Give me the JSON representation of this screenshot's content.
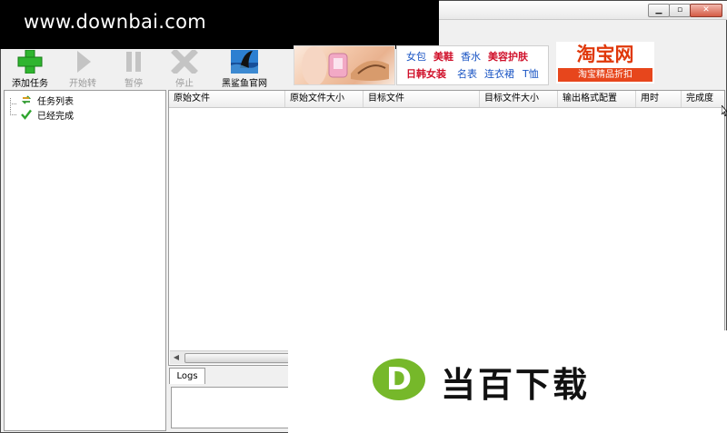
{
  "watermark": {
    "text": "www.downbai.com"
  },
  "window": {
    "min": "▁",
    "max": "▫",
    "close": "✕"
  },
  "toolbar": {
    "add_task": "添加任务",
    "start": "开始转",
    "pause": "暂停",
    "stop": "停止",
    "official_site": "黑鲨鱼官网"
  },
  "ads": {
    "links": [
      {
        "text": "女包",
        "color": "#1a55c4"
      },
      {
        "text": "美鞋",
        "color": "#d0102a"
      },
      {
        "text": "香水",
        "color": "#1a55c4"
      },
      {
        "text": "美容护肤",
        "color": "#d0102a"
      },
      {
        "text": "日韩女装",
        "color": "#d0102a"
      },
      {
        "text": "名表",
        "color": "#1a55c4"
      },
      {
        "text": "连衣裙",
        "color": "#1a55c4"
      },
      {
        "text": "T恤",
        "color": "#1a55c4"
      }
    ],
    "taobao_title": "淘宝网",
    "taobao_sub": "淘宝精品折扣"
  },
  "tree": {
    "items": [
      {
        "label": "任务列表",
        "icon": "refresh-icon"
      },
      {
        "label": "已经完成",
        "icon": "checkmark-icon"
      }
    ]
  },
  "table": {
    "columns": [
      "原始文件",
      "原始文件大小",
      "目标文件",
      "目标文件大小",
      "输出格式配置",
      "用时",
      "完成度"
    ]
  },
  "logs": {
    "tab": "Logs"
  },
  "logo": {
    "mark": "D",
    "text": "当百下载"
  }
}
